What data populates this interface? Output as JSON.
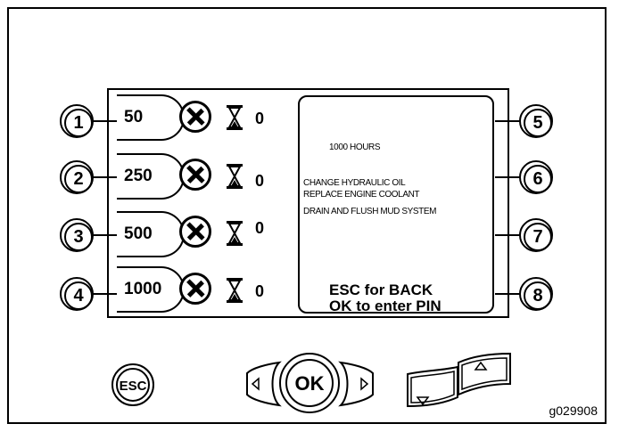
{
  "left_buttons": [
    "1",
    "2",
    "3",
    "4"
  ],
  "right_buttons": [
    "5",
    "6",
    "7",
    "8"
  ],
  "service_intervals": [
    {
      "hours": "50",
      "count": "0"
    },
    {
      "hours": "250",
      "count": "0"
    },
    {
      "hours": "500",
      "count": "0"
    },
    {
      "hours": "1000",
      "count": "0"
    }
  ],
  "detail": {
    "title": "1000 HOURS",
    "tasks": [
      "CHANGE HYDRAULIC OIL",
      "REPLACE ENGINE COOLANT",
      "DRAIN AND FLUSH MUD SYSTEM"
    ],
    "hint_back": "ESC for BACK",
    "hint_pin": "OK to enter PIN"
  },
  "controls": {
    "esc": "ESC",
    "ok": "OK"
  },
  "figure_id": "g029908",
  "icons": [
    "wrench-screwdriver-icon",
    "hourglass-icon",
    "left-arrow-icon",
    "right-arrow-icon",
    "down-arrow-icon",
    "up-arrow-icon"
  ]
}
